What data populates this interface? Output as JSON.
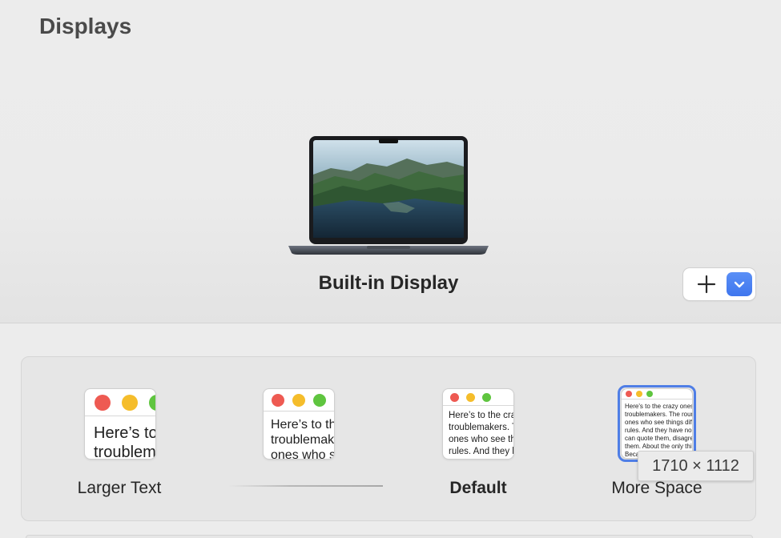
{
  "window": {
    "title": "Displays"
  },
  "display": {
    "name": "Built-in Display"
  },
  "toolbar": {
    "add_icon": "plus-icon",
    "menu_icon": "chevron-down-icon",
    "accent": "#3f76ee"
  },
  "resolution": {
    "options": [
      {
        "label": "Larger Text",
        "sample": "Here’s to the crazy ones, the\ntroublemakers."
      },
      {
        "label": "",
        "sample": "Here’s to the crazy ones. The\ntroublemakers. The rebels\nones who see things"
      },
      {
        "label": "Default",
        "sample": "Here’s to the crazy ones.\ntroublemakers. The rebels\nones who see things differently.\nrules. And they have no"
      },
      {
        "label": "More Space",
        "sample": "Here's to the crazy ones. The misfits.\ntroublemakers. The round pegs\nones who see things differently.\nrules. And they have no respect\ncan quote them, disagree with\nthem. About the only thing\nBecause they change things."
      }
    ],
    "selected_index": 3,
    "tooltip": "1710 × 1112"
  }
}
